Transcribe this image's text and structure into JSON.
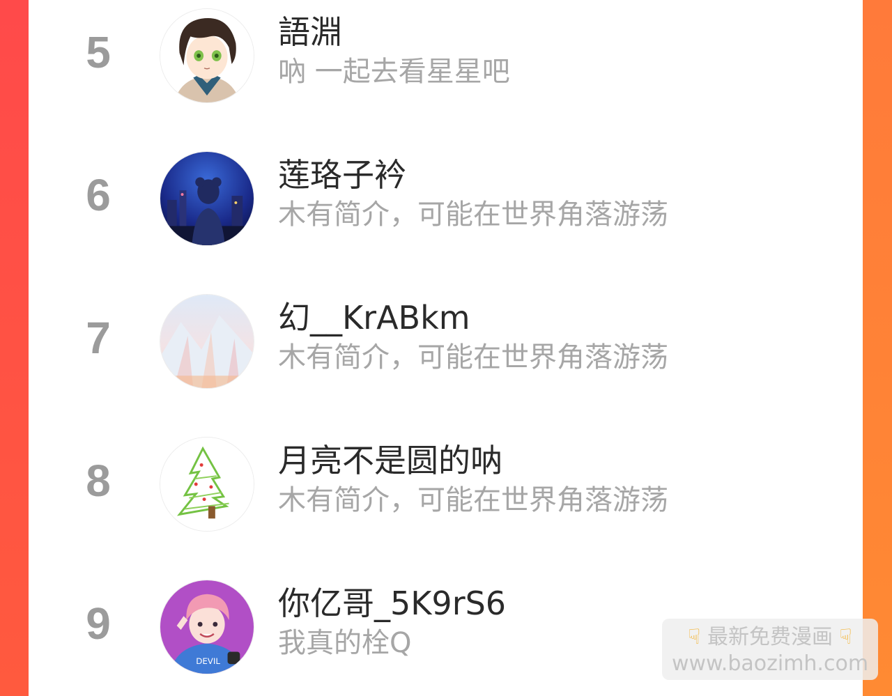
{
  "ranking": {
    "items": [
      {
        "rank": "5",
        "name": "語淵",
        "bio": "吶 一起去看星星吧",
        "avatar_icon": "anime-boy-avatar"
      },
      {
        "rank": "6",
        "name": "莲珞子衿",
        "bio": "木有简介，可能在世界角落游荡",
        "avatar_icon": "night-city-girl-avatar"
      },
      {
        "rank": "7",
        "name": "幻__KrABkm",
        "bio": "木有简介，可能在世界角落游荡",
        "avatar_icon": "pastel-landscape-avatar"
      },
      {
        "rank": "8",
        "name": "月亮不是圆的呐",
        "bio": "木有简介，可能在世界角落游荡",
        "avatar_icon": "christmas-tree-drawing-avatar"
      },
      {
        "rank": "9",
        "name": "你亿哥_5K9rS6",
        "bio": "我真的栓Q",
        "avatar_icon": "pink-hair-boy-avatar"
      }
    ]
  },
  "watermark": {
    "line1": "最新免费漫画",
    "line2": "www.baozimh.com",
    "hand_icon": "pointing-down-hand-icon"
  },
  "colors": {
    "left_border": "#ff4a4a",
    "right_border": "#ff8a33",
    "rank_text": "#9b9b9b",
    "name_text": "#2a2a2a",
    "bio_text": "#a6a6a6"
  }
}
